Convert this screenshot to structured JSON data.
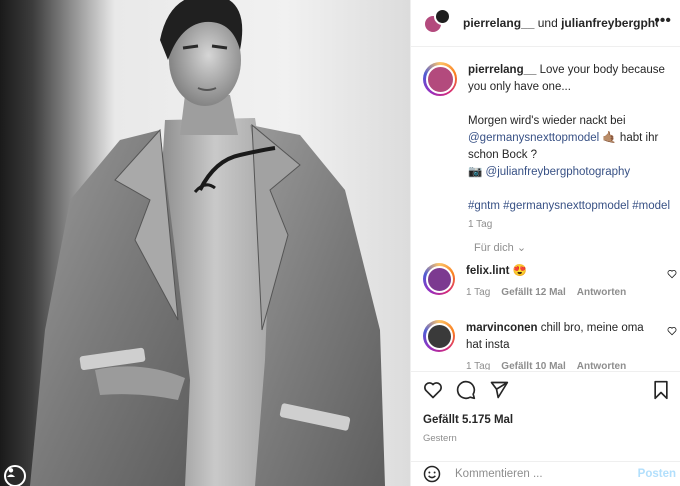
{
  "header": {
    "author": "pierrelang__",
    "connector": "und",
    "coauthor": "julianfreybergphotography"
  },
  "caption": {
    "username": "pierrelang__",
    "line1": "Love your body because you only have one...",
    "line2_a": "Morgen wird's wieder nackt bei",
    "mention1": "@germanysnexttopmodel",
    "line2_b": "🤙🏽 habt ihr schon Bock ?",
    "camera": "📷",
    "mention2": "@julianfreybergphotography",
    "hashtags": "#gntm #germanysnexttopmodel #model",
    "time": "1 Tag"
  },
  "for_you": "Für dich",
  "comments": [
    {
      "username": "felix.lint",
      "text": "😍",
      "time": "1 Tag",
      "likes": "Gefällt 12 Mal",
      "reply": "Antworten"
    },
    {
      "username": "marvinconen",
      "text": "chill bro, meine oma hat insta",
      "time": "1 Tag",
      "likes": "Gefällt 10 Mal",
      "reply": "Antworten"
    }
  ],
  "actions": {
    "likes_text": "Gefällt 5.175 Mal",
    "date": "Gestern"
  },
  "compose": {
    "placeholder": "Kommentieren ...",
    "post_label": "Posten"
  },
  "icons": {
    "more": "more-options-icon",
    "like": "heart-icon",
    "comment": "comment-icon",
    "share": "share-icon",
    "save": "bookmark-icon",
    "emoji": "emoji-icon"
  },
  "colors": {
    "link": "#385185",
    "muted": "#8e8e8e",
    "post_disabled": "#b2dffc"
  }
}
